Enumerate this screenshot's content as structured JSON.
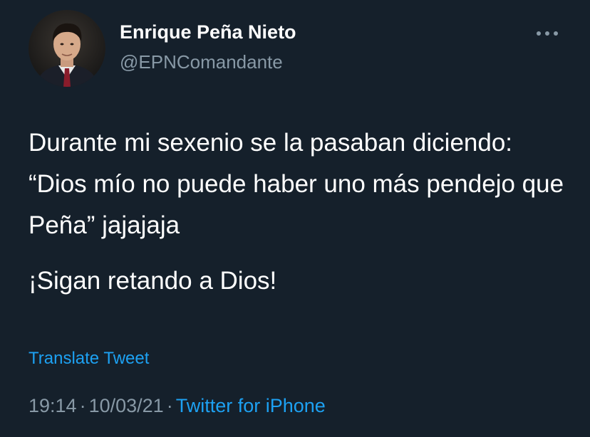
{
  "tweet": {
    "author": {
      "display_name": "Enrique Peña Nieto",
      "handle": "@EPNComandante",
      "avatar_icon": "profile-photo"
    },
    "more_icon": "more-horizontal-icon",
    "body": {
      "paragraphs": [
        "Durante mi sexenio se la pasaban diciendo: “Dios mío no puede haber uno más pendejo que Peña” jajajaja",
        "¡Sigan retando a Dios!"
      ]
    },
    "translate_label": "Translate Tweet",
    "meta": {
      "time": "19:14",
      "separator": "·",
      "date": "10/03/21",
      "source": "Twitter for iPhone"
    }
  },
  "colors": {
    "background": "#15202b",
    "primary_text": "#ffffff",
    "secondary_text": "#8899a6",
    "accent": "#1da1f2"
  }
}
